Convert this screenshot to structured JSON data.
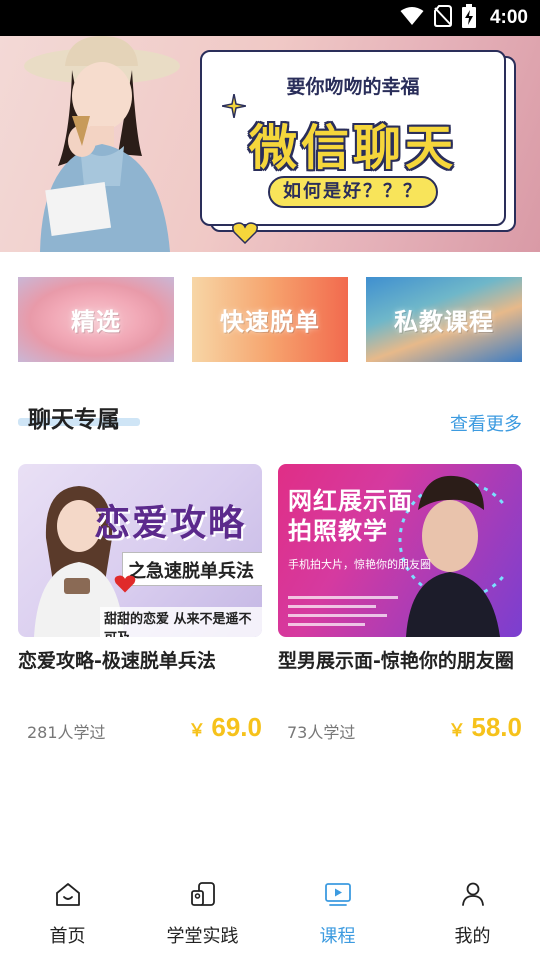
{
  "status_bar": {
    "time": "4:00",
    "icons": [
      "wifi-icon",
      "no-sim-icon",
      "battery-charging-icon"
    ]
  },
  "banner": {
    "subtitle": "要你吻吻的幸福",
    "headline": "微信聊天",
    "pill": "如何是好？？？"
  },
  "categories": [
    {
      "label": "精选"
    },
    {
      "label": "快速脱单"
    },
    {
      "label": "私教课程"
    }
  ],
  "section": {
    "title": "聊天专属",
    "see_more": "查看更多"
  },
  "courses": [
    {
      "title": "恋爱攻略-极速脱单兵法",
      "learners": "281人学过",
      "currency": "￥",
      "price": "69.0",
      "thumb": {
        "title": "恋爱攻略",
        "band": "之急速脱单兵法",
        "bottom": "甜甜的恋爱 从来不是遥不可及"
      }
    },
    {
      "title": "型男展示面-惊艳你的朋友圈",
      "learners": "73人学过",
      "currency": "￥",
      "price": "58.0",
      "thumb": {
        "title_line1": "网红展示面",
        "title_line2": "拍照教学",
        "sub": "手机拍大片，惊艳你的朋友圈"
      }
    }
  ],
  "nav": [
    {
      "label": "首页",
      "icon": "home-icon"
    },
    {
      "label": "学堂实践",
      "icon": "practice-icon"
    },
    {
      "label": "课程",
      "icon": "video-course-icon",
      "active": true
    },
    {
      "label": "我的",
      "icon": "profile-icon"
    }
  ],
  "colors": {
    "accent": "#3d9be0",
    "price": "#f6c21b"
  }
}
